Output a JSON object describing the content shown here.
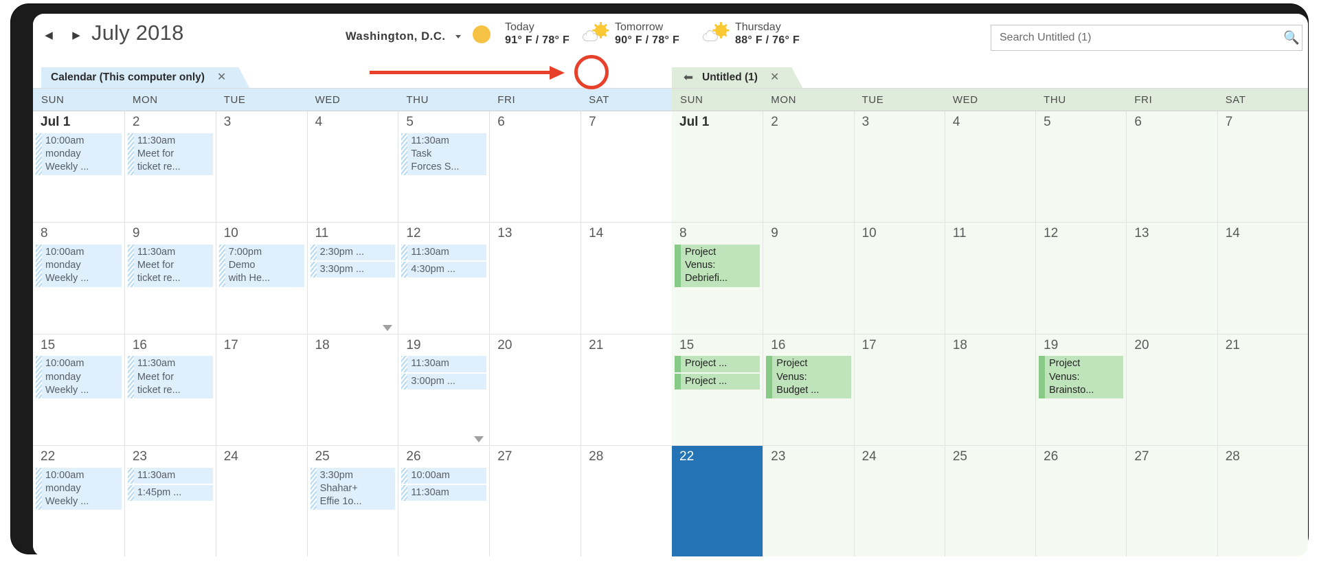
{
  "header": {
    "prev_icon": "left-triangle-icon",
    "next_icon": "right-triangle-icon",
    "month_title": "July 2018",
    "location": "Washington,  D.C.",
    "weather": [
      {
        "day": "Today",
        "temp": "91° F / 78° F",
        "icon": "moon-icon"
      },
      {
        "day": "Tomorrow",
        "temp": "90° F / 78° F",
        "icon": "sun-cloud-icon"
      },
      {
        "day": "Thursday",
        "temp": "88° F / 76° F",
        "icon": "sun-cloud-icon"
      }
    ],
    "search": {
      "placeholder": "Search Untitled (1)",
      "value": "",
      "icon": "search-icon"
    }
  },
  "left_pane": {
    "tab": {
      "label": "Calendar (This computer only)",
      "close": "✕"
    },
    "dow": [
      "SUN",
      "MON",
      "TUE",
      "WED",
      "THU",
      "FRI",
      "SAT"
    ],
    "weeks": [
      [
        {
          "num": "Jul 1",
          "first": true,
          "events": [
            {
              "text": "10:00am\nmonday\nWeekly ..."
            }
          ]
        },
        {
          "num": "2",
          "events": [
            {
              "text": "11:30am\nMeet for\nticket re..."
            }
          ]
        },
        {
          "num": "3",
          "events": []
        },
        {
          "num": "4",
          "events": []
        },
        {
          "num": "5",
          "events": [
            {
              "text": "11:30am\nTask\nForces S..."
            }
          ]
        },
        {
          "num": "6",
          "events": []
        },
        {
          "num": "7",
          "events": []
        }
      ],
      [
        {
          "num": "8",
          "events": [
            {
              "text": "10:00am\nmonday\nWeekly ..."
            }
          ]
        },
        {
          "num": "9",
          "events": [
            {
              "text": "11:30am\nMeet for\nticket re..."
            }
          ]
        },
        {
          "num": "10",
          "events": [
            {
              "text": "7:00pm\nDemo\nwith He..."
            }
          ]
        },
        {
          "num": "11",
          "more": true,
          "events": [
            {
              "text": "2:30pm ..."
            },
            {
              "text": "3:30pm ..."
            }
          ]
        },
        {
          "num": "12",
          "events": [
            {
              "text": "11:30am"
            },
            {
              "text": "4:30pm ..."
            }
          ]
        },
        {
          "num": "13",
          "events": []
        },
        {
          "num": "14",
          "events": []
        }
      ],
      [
        {
          "num": "15",
          "events": [
            {
              "text": "10:00am\nmonday\nWeekly ..."
            }
          ]
        },
        {
          "num": "16",
          "events": [
            {
              "text": "11:30am\nMeet for\nticket re..."
            }
          ]
        },
        {
          "num": "17",
          "events": []
        },
        {
          "num": "18",
          "events": []
        },
        {
          "num": "19",
          "more": true,
          "events": [
            {
              "text": "11:30am"
            },
            {
              "text": "3:00pm ..."
            }
          ]
        },
        {
          "num": "20",
          "events": []
        },
        {
          "num": "21",
          "events": []
        }
      ],
      [
        {
          "num": "22",
          "events": [
            {
              "text": "10:00am\nmonday\nWeekly ..."
            }
          ]
        },
        {
          "num": "23",
          "events": [
            {
              "text": "11:30am"
            },
            {
              "text": "1:45pm ..."
            }
          ]
        },
        {
          "num": "24",
          "events": []
        },
        {
          "num": "25",
          "events": [
            {
              "text": "3:30pm\nShahar+\nEffie 1o..."
            }
          ]
        },
        {
          "num": "26",
          "events": [
            {
              "text": "10:00am"
            },
            {
              "text": "11:30am"
            }
          ]
        },
        {
          "num": "27",
          "events": []
        },
        {
          "num": "28",
          "events": []
        }
      ]
    ]
  },
  "right_pane": {
    "tab": {
      "label": "Untitled (1)",
      "close": "✕",
      "back_icon": "back-arrow-icon"
    },
    "dow": [
      "SUN",
      "MON",
      "TUE",
      "WED",
      "THU",
      "FRI",
      "SAT"
    ],
    "weeks": [
      [
        {
          "num": "Jul 1",
          "first": true,
          "events": []
        },
        {
          "num": "2",
          "events": []
        },
        {
          "num": "3",
          "events": []
        },
        {
          "num": "4",
          "events": []
        },
        {
          "num": "5",
          "events": []
        },
        {
          "num": "6",
          "events": []
        },
        {
          "num": "7",
          "events": []
        }
      ],
      [
        {
          "num": "8",
          "events": [
            {
              "text": "Project\nVenus:\nDebriefi..."
            }
          ]
        },
        {
          "num": "9",
          "events": []
        },
        {
          "num": "10",
          "events": []
        },
        {
          "num": "11",
          "events": []
        },
        {
          "num": "12",
          "events": []
        },
        {
          "num": "13",
          "events": []
        },
        {
          "num": "14",
          "events": []
        }
      ],
      [
        {
          "num": "15",
          "events": [
            {
              "text": "Project ..."
            },
            {
              "text": "Project ..."
            }
          ]
        },
        {
          "num": "16",
          "events": [
            {
              "text": "Project\nVenus:\nBudget ..."
            }
          ]
        },
        {
          "num": "17",
          "events": []
        },
        {
          "num": "18",
          "events": []
        },
        {
          "num": "19",
          "events": [
            {
              "text": "Project\nVenus:\nBrainsto..."
            }
          ]
        },
        {
          "num": "20",
          "events": []
        },
        {
          "num": "21",
          "events": []
        }
      ],
      [
        {
          "num": "22",
          "selected": true,
          "events": []
        },
        {
          "num": "23",
          "events": []
        },
        {
          "num": "24",
          "events": []
        },
        {
          "num": "25",
          "events": []
        },
        {
          "num": "26",
          "events": []
        },
        {
          "num": "27",
          "events": []
        },
        {
          "num": "28",
          "events": []
        }
      ]
    ]
  },
  "annotation": {
    "type": "arrow-and-circle",
    "color": "#e8412b",
    "points_at": "back-arrow-icon"
  },
  "colors": {
    "blue_tab": "#d9ecf9",
    "green_tab": "#dfecdc",
    "blue_event": "#dfeffc",
    "green_event": "#bfe3bb",
    "selected_day": "#2474b5",
    "annotation": "#e8412b"
  }
}
